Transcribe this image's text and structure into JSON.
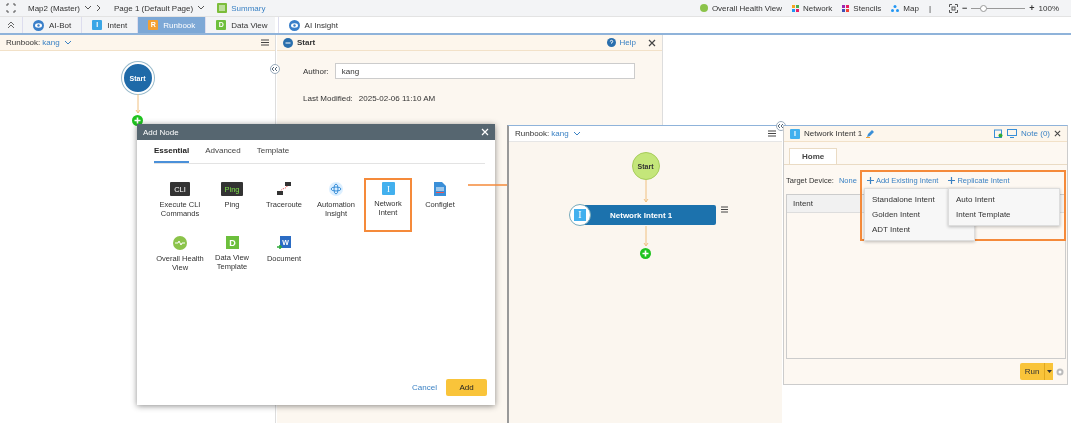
{
  "top_bar": {
    "breadcrumbs": [
      "Map2 (Master)",
      "Page 1 (Default Page)"
    ],
    "summary": "Summary",
    "right_items": [
      {
        "label": "Overall Health View",
        "kind": "health"
      },
      {
        "label": "Network",
        "kind": "network"
      },
      {
        "label": "Stencils",
        "kind": "stencils"
      },
      {
        "label": "Map",
        "kind": "map"
      }
    ],
    "separator": "|",
    "zoom": {
      "minus": "−",
      "plus": "+",
      "level": 0.22,
      "reading": "100%"
    }
  },
  "tabs": [
    {
      "label": "AI-Bot",
      "kind": "eye",
      "selected": false
    },
    {
      "label": "Intent",
      "kind": "letter",
      "badge": "I",
      "color": "#3aa6e6",
      "selected": false
    },
    {
      "label": "Runbook",
      "kind": "letter",
      "badge": "R",
      "color": "#f5a030",
      "selected": true
    },
    {
      "label": "Data View",
      "kind": "letter",
      "badge": "D",
      "color": "#6cbf3c",
      "selected": false
    },
    {
      "label": "AI Insight",
      "kind": "eye",
      "selected": false
    }
  ],
  "left_panel": {
    "runbook_label": "Runbook:",
    "runbook": "kang",
    "start": "Start"
  },
  "start_panel": {
    "title": "Start",
    "help": "Help",
    "author_label": "Author:",
    "author": "kang",
    "modified_label": "Last Modified:",
    "modified": "2025-02-06 11:10 AM"
  },
  "dialog": {
    "title": "Add Node",
    "tabs": [
      {
        "label": "Essential",
        "selected": true
      },
      {
        "label": "Advanced",
        "selected": false
      },
      {
        "label": "Template",
        "selected": false
      }
    ],
    "items": [
      {
        "label": "Execute CLI Commands",
        "kind": "cli",
        "badge": "CLI",
        "highlighted": false
      },
      {
        "label": "Ping",
        "kind": "ping",
        "badge": "Ping",
        "highlighted": false
      },
      {
        "label": "Traceroute",
        "kind": "traceroute",
        "highlighted": false
      },
      {
        "label": "Automation Insight",
        "kind": "automation",
        "highlighted": false
      },
      {
        "label": "Network Intent",
        "kind": "intent",
        "badge": "I",
        "highlighted": true
      },
      {
        "label": "Configlet",
        "kind": "configlet",
        "highlighted": false
      },
      {
        "label": "Overall Health View",
        "kind": "health",
        "highlighted": false
      },
      {
        "label": "Data View Template",
        "kind": "dataview",
        "badge": "D",
        "highlighted": false
      },
      {
        "label": "Document",
        "kind": "document",
        "badge": "W",
        "highlighted": false
      }
    ],
    "cancel": "Cancel",
    "add": "Add"
  },
  "runbook_panel": {
    "runbook_label": "Runbook:",
    "runbook": "kang",
    "start": "Start",
    "node": {
      "label": "Network Intent 1",
      "badge": "I"
    }
  },
  "intent_panel": {
    "title": "Network Intent 1",
    "badge": "I",
    "note": "Note (0)",
    "tabs": [
      {
        "label": "Home",
        "selected": true
      }
    ],
    "target_label": "Target Device:",
    "target": "None",
    "actions": [
      "Add Existing Intent",
      "Replicate Intent"
    ],
    "menus": [
      [
        "Standalone Intent",
        "Golden Intent",
        "ADT Intent"
      ],
      [
        "Auto Intent",
        "Intent Template"
      ]
    ],
    "table_header": "Intent",
    "run": "Run"
  }
}
